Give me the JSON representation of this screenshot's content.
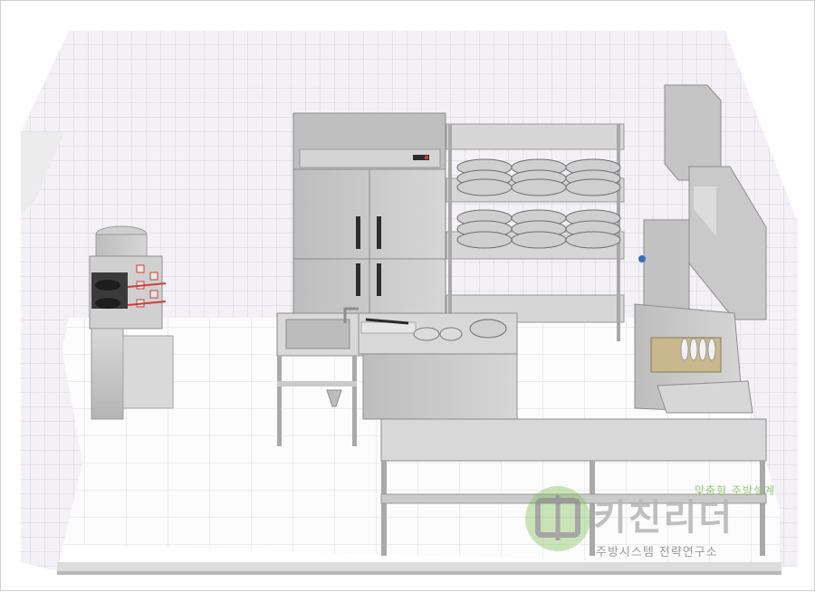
{
  "scene": {
    "description_hidden": "",
    "colors": {
      "wall": "#f3f0f5",
      "grid": "#d9d5df",
      "floor": "#fbfbfb",
      "steel": "#c9c9c9",
      "steel_dark": "#a8a8a8",
      "accent_red": "#d23b3b",
      "logo_green": "#7fbf57"
    }
  },
  "watermark": {
    "tagline": "맞춤형 주방설계",
    "brand": "키친리더",
    "subtitle": "주방시스템 전략연구소"
  },
  "equipment_icons": [
    "stock-pot-icon",
    "gas-range-icon",
    "refrigerator-icon",
    "plate-rack-icon",
    "sink-icon",
    "work-table-icon",
    "dishwasher-icon",
    "wall-cabinet-icon"
  ]
}
